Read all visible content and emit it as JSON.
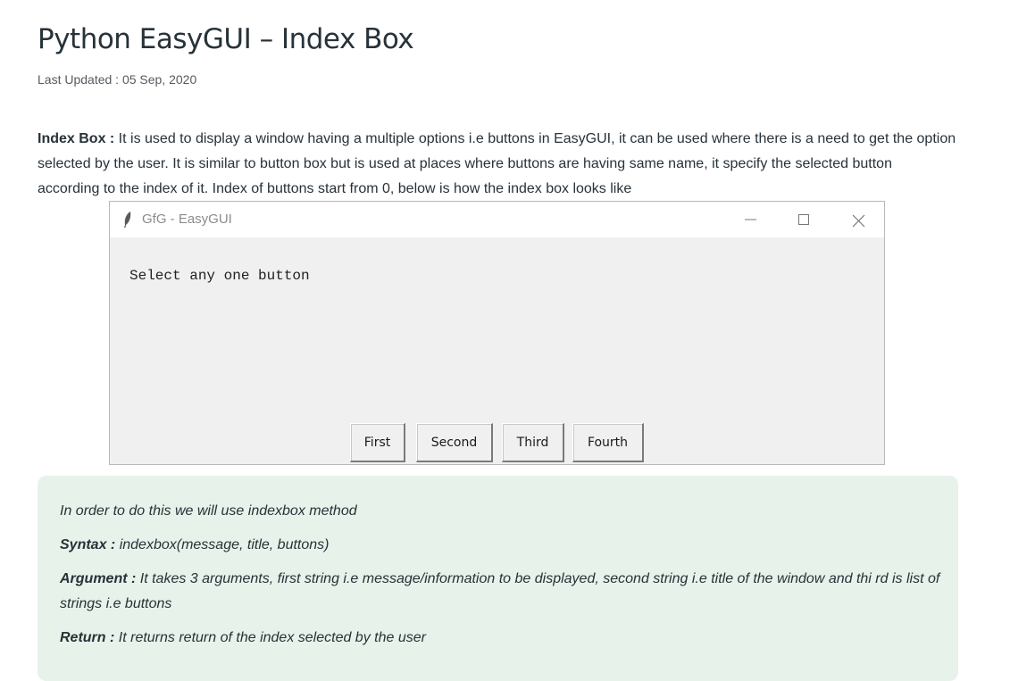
{
  "article": {
    "title": "Python EasyGUI – Index Box",
    "last_updated": "Last Updated : 05 Sep, 2020",
    "intro_label": "Index Box :",
    "intro_text": " It is used to display a window having a multiple options i.e buttons in EasyGUI, it can be used where there is a need to get the option selected by the user. It is similar to button box but is used at places where buttons are having same name, it specify the selected button according to the index of it. Index of buttons start from 0, below is how the index box looks like"
  },
  "window": {
    "title": "GfG - EasyGUI",
    "message": "Select any one button",
    "buttons": [
      "First",
      "Second",
      "Third",
      "Fourth"
    ],
    "icons": {
      "app": "feather-icon",
      "minimize": "minimize-icon",
      "maximize": "maximize-icon",
      "close": "close-icon"
    }
  },
  "info": {
    "line1_pre": "In order to do this we will use ",
    "line1_method": "indexbox",
    "line1_post": " method",
    "syntax_label": "Syntax :",
    "syntax_text": " indexbox(message, title, buttons)",
    "argument_label": "Argument :",
    "argument_text": " It takes 3 arguments, first string i.e message/information to be displayed, second string i.e title of the window and thi rd is list of strings i.e buttons",
    "return_label": "Return :",
    "return_text": " It returns return of the index selected by the user"
  },
  "colors": {
    "text": "#273239",
    "info_background": "#e7f2ea",
    "window_background": "#f0f0f0"
  }
}
